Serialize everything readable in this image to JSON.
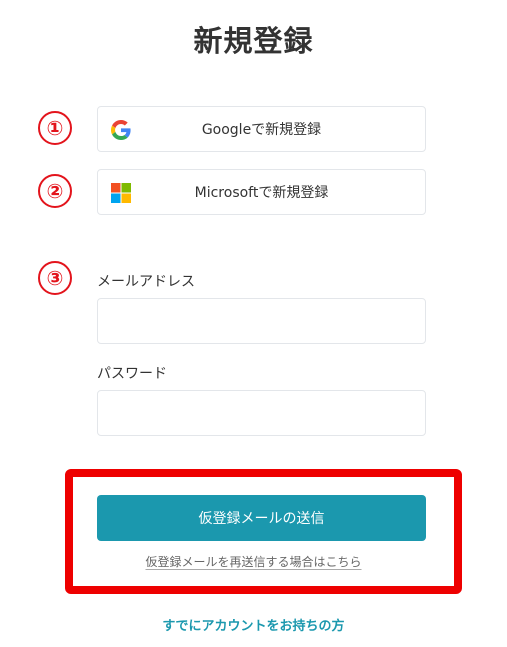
{
  "page": {
    "title": "新規登録"
  },
  "markers": {
    "one": "①",
    "two": "②",
    "three": "③"
  },
  "sso": {
    "google_label": "Googleで新規登録",
    "google_icon": "google-g-icon",
    "microsoft_label": "Microsoftで新規登録",
    "microsoft_icon": "microsoft-squares-icon"
  },
  "form": {
    "email_label": "メールアドレス",
    "email_value": "",
    "password_label": "パスワード",
    "password_value": ""
  },
  "actions": {
    "submit_label": "仮登録メールの送信",
    "resend_label": "仮登録メールを再送信する場合はこちら",
    "login_label": "すでにアカウントをお持ちの方"
  },
  "colors": {
    "accent": "#1b98ae",
    "highlight": "#ee0000",
    "marker": "#e3141c",
    "google_blue": "#4285F4",
    "google_red": "#EA4335",
    "google_yellow": "#FBBC05",
    "google_green": "#34A853",
    "ms_red": "#F25022",
    "ms_green": "#7FBA00",
    "ms_blue": "#00A4EF",
    "ms_yellow": "#FFB900"
  }
}
